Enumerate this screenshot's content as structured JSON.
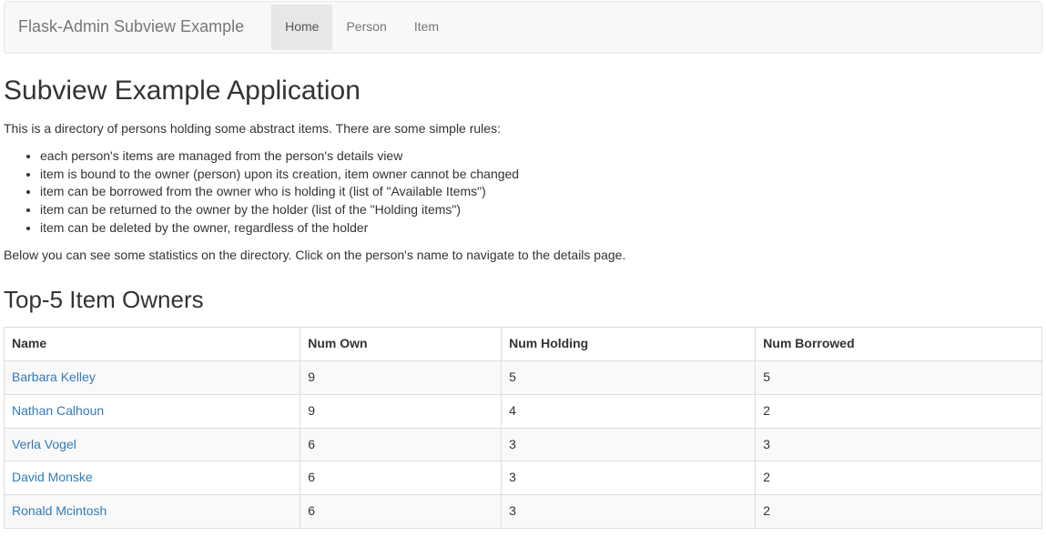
{
  "navbar": {
    "brand": "Flask-Admin Subview Example",
    "items": [
      {
        "label": "Home",
        "active": true
      },
      {
        "label": "Person",
        "active": false
      },
      {
        "label": "Item",
        "active": false
      }
    ]
  },
  "page": {
    "title": "Subview Example Application",
    "intro": "This is a directory of persons holding some abstract items. There are some simple rules:",
    "rules": [
      "each person's items are managed from the person's details view",
      "item is bound to the owner (person) upon its creation, item owner cannot be changed",
      "item can be borrowed from the owner who is holding it (list of \"Available Items\")",
      "item can be returned to the owner by the holder (list of the \"Holding items\")",
      "item can be deleted by the owner, regardless of the holder"
    ],
    "below_text": "Below you can see some statistics on the directory. Click on the person's name to navigate to the details page."
  },
  "top5": {
    "heading": "Top-5 Item Owners",
    "columns": [
      "Name",
      "Num Own",
      "Num Holding",
      "Num Borrowed"
    ],
    "rows": [
      {
        "name": "Barbara Kelley",
        "own": 9,
        "holding": 5,
        "borrowed": 5
      },
      {
        "name": "Nathan Calhoun",
        "own": 9,
        "holding": 4,
        "borrowed": 2
      },
      {
        "name": "Verla Vogel",
        "own": 6,
        "holding": 3,
        "borrowed": 3
      },
      {
        "name": "David Monske",
        "own": 6,
        "holding": 3,
        "borrowed": 2
      },
      {
        "name": "Ronald Mcintosh",
        "own": 6,
        "holding": 3,
        "borrowed": 2
      }
    ]
  }
}
